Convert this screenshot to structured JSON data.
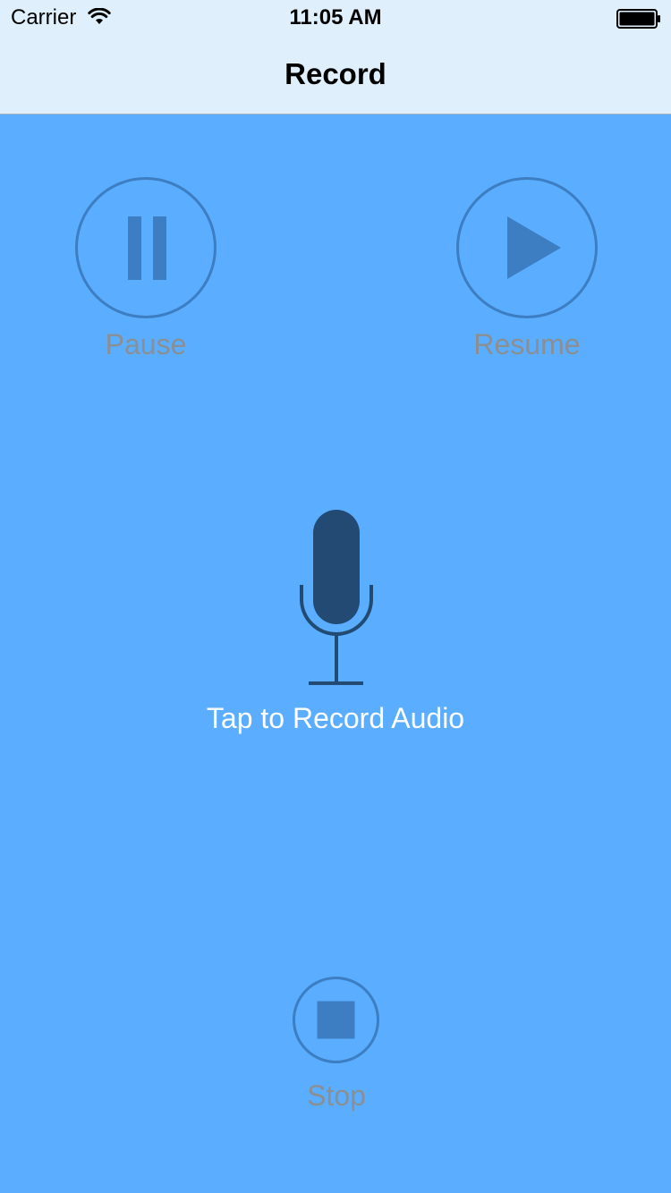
{
  "status_bar": {
    "carrier": "Carrier",
    "time": "11:05 AM",
    "icons": [
      "wifi-icon",
      "battery-icon"
    ]
  },
  "nav": {
    "title": "Record"
  },
  "controls": {
    "pause_label": "Pause",
    "resume_label": "Resume",
    "stop_label": "Stop",
    "record_label": "Tap to Record Audio"
  },
  "colors": {
    "background": "#5aadff",
    "navbar": "#dff0fc",
    "control_accent": "#3d7dc1",
    "mic": "#224a72",
    "disabled_label": "#8a8f94"
  }
}
